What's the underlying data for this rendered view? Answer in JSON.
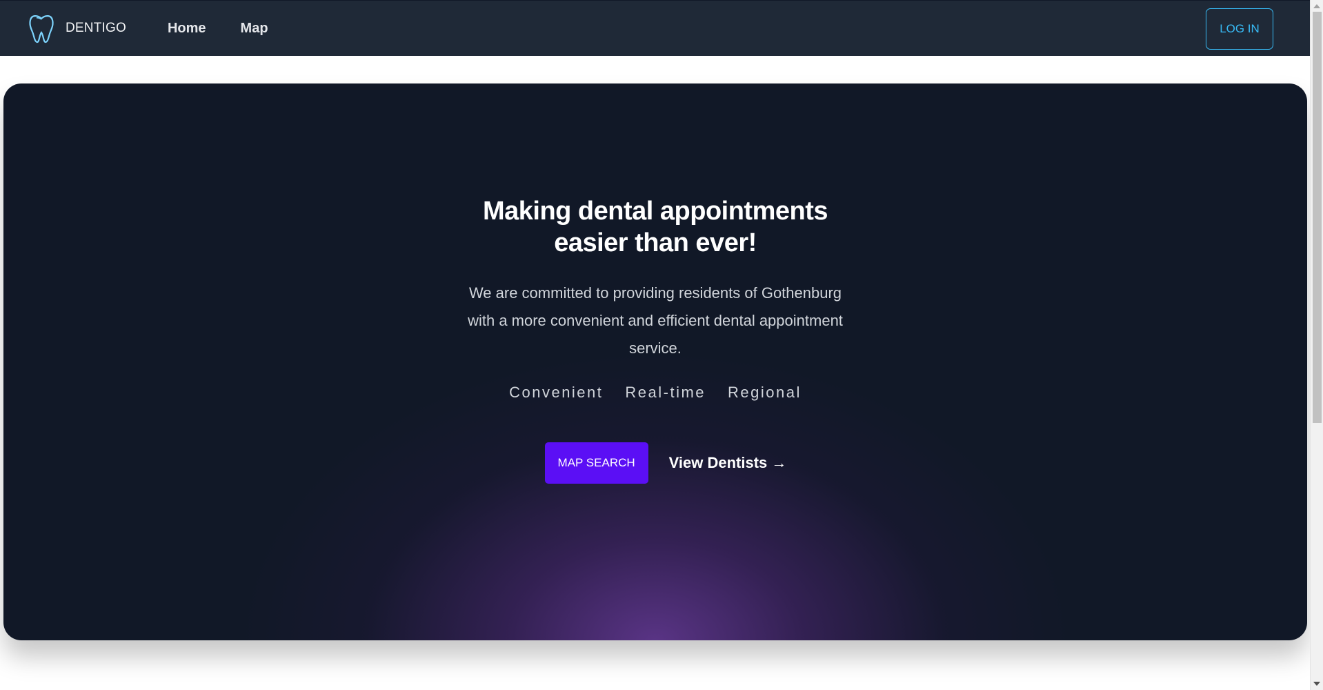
{
  "header": {
    "brand_name": "DENTIGO",
    "nav": [
      {
        "label": "Home"
      },
      {
        "label": "Map"
      }
    ],
    "login_label": "LOG IN",
    "logo_icon": "tooth-icon"
  },
  "hero": {
    "title_line1": "Making dental appointments",
    "title_line2": "easier than ever!",
    "description": "We are committed to providing residents of Gothenburg with a more convenient and efficient dental appointment service.",
    "tags": [
      "Convenient",
      "Real-time",
      "Regional"
    ],
    "primary_button": "MAP SEARCH",
    "secondary_link": "View Dentists →"
  },
  "colors": {
    "nav_bg": "#1f2937",
    "hero_bg": "#111827",
    "accent_button": "#5b0ff5",
    "login_outline": "#38bdf8"
  }
}
